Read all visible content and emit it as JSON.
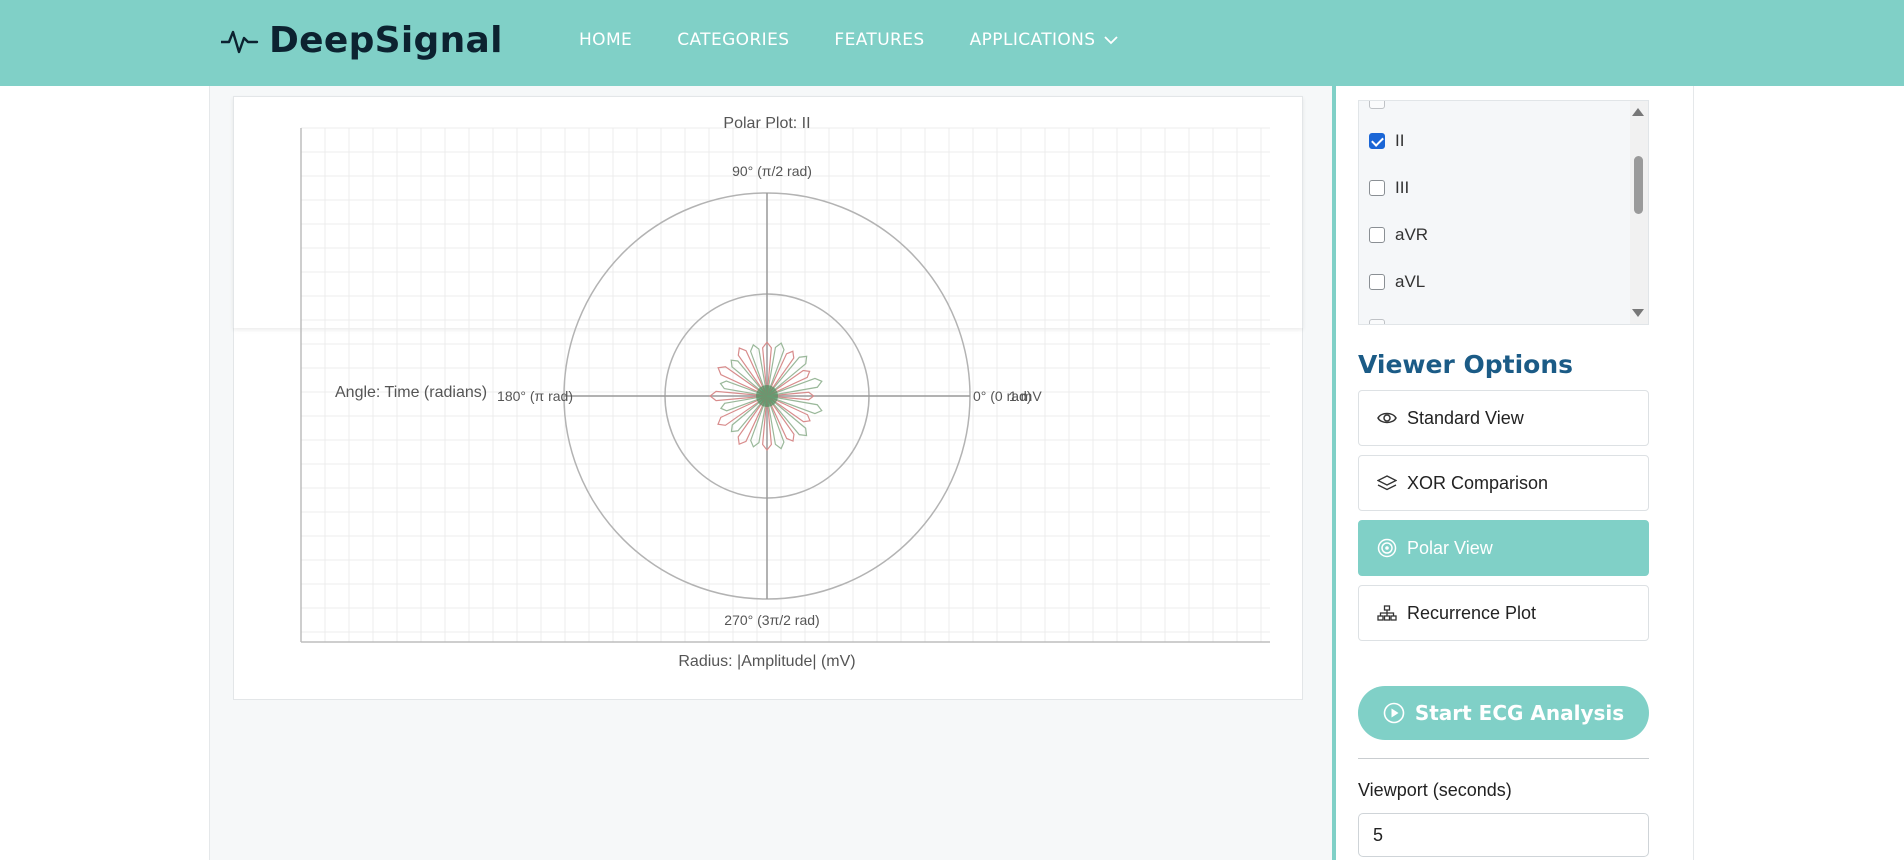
{
  "nav": {
    "brand": "DeepSignal",
    "links": [
      {
        "label": "HOME"
      },
      {
        "label": "CATEGORIES"
      },
      {
        "label": "FEATURES"
      },
      {
        "label": "APPLICATIONS"
      }
    ]
  },
  "chart": {
    "title": "Polar Plot: II",
    "xlabel": "Radius: |Amplitude| (mV)",
    "ylabel": "Angle: Time (radians)",
    "angle_labels": {
      "a90": "90° (π/2 rad)",
      "a180": "180° (π rad)",
      "a0": "0° (0 rad)",
      "a270": "270° (3π/2 rad)",
      "radius_unit": "1 mV"
    }
  },
  "chart_data": {
    "type": "polar",
    "title": "Polar Plot: II",
    "xlabel": "Radius: |Amplitude| (mV)",
    "ylabel": "Angle: Time (radians)",
    "radial_rings": [
      0.5,
      1
    ],
    "angles": [
      "0° (0 rad)",
      "90° (π/2 rad)",
      "180° (π rad)",
      "270° (3π/2 rad)"
    ],
    "petal_count": 24,
    "max_radius_mV": 0.28,
    "grid": true,
    "colors": {
      "series_a": "#d88c8c",
      "series_b": "#9ab89a",
      "center": "#4f8f5f"
    }
  },
  "leads": {
    "items": [
      {
        "label": "II",
        "checked": true
      },
      {
        "label": "III",
        "checked": false
      },
      {
        "label": "aVR",
        "checked": false
      },
      {
        "label": "aVL",
        "checked": false
      }
    ]
  },
  "viewer": {
    "title": "Viewer Options",
    "options": [
      {
        "label": "Standard View",
        "icon": "eye-icon",
        "active": false
      },
      {
        "label": "XOR Comparison",
        "icon": "layers-icon",
        "active": false
      },
      {
        "label": "Polar View",
        "icon": "target-icon",
        "active": true
      },
      {
        "label": "Recurrence Plot",
        "icon": "hierarchy-icon",
        "active": false
      }
    ]
  },
  "start_button": "Start ECG Analysis",
  "viewport": {
    "label": "Viewport (seconds)",
    "value": "5"
  },
  "colors": {
    "accent": "#80d0c7",
    "heading": "#1b5b86",
    "brand_text": "#0c2230"
  }
}
